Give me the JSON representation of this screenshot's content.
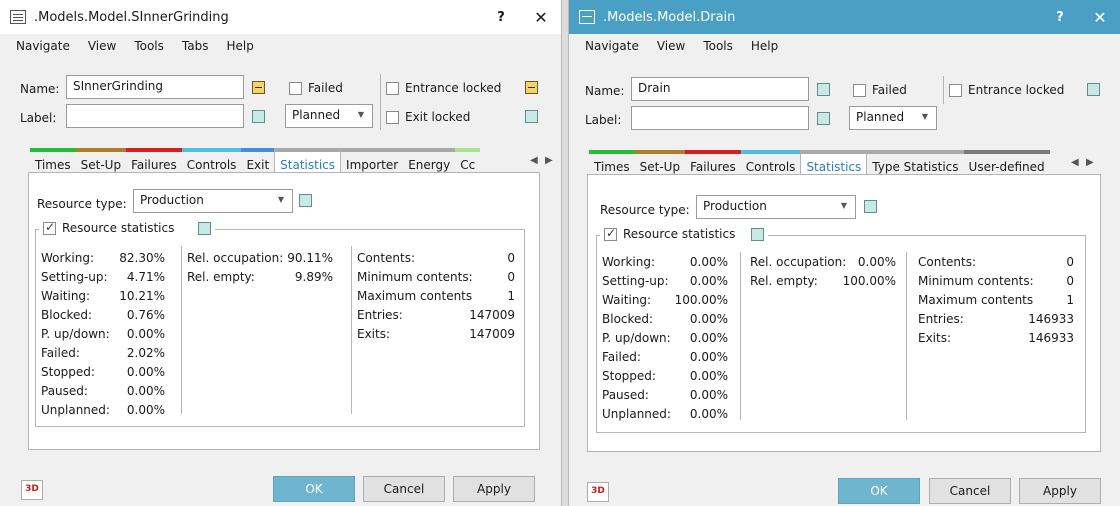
{
  "left": {
    "title": ".Models.Model.SInnerGrinding",
    "help": "?",
    "close": "✕",
    "menu": [
      "Navigate",
      "View",
      "Tools",
      "Tabs",
      "Help"
    ],
    "name_label": "Name:",
    "name_value": "SInnerGrinding",
    "label_label": "Label:",
    "label_value": "",
    "failed_label": "Failed",
    "status_value": "Planned",
    "entrance_locked_label": "Entrance locked",
    "exit_locked_label": "Exit locked",
    "tabs": [
      "Times",
      "Set-Up",
      "Failures",
      "Controls",
      "Exit",
      "Statistics",
      "Importer",
      "Energy",
      "Cc"
    ],
    "tab_colors": [
      "#1fbf3a",
      "#b07c2a",
      "#d62020",
      "#4fbfe0",
      "#3f8ee0",
      "#a9a9a9",
      "#a9a9a9",
      "#a9a9a9",
      "#a6e68a"
    ],
    "active_tab": "Statistics",
    "resource_type_label": "Resource type:",
    "resource_type_value": "Production",
    "resource_statistics_label": "Resource statistics",
    "col1": [
      {
        "label": "Working:",
        "value": "82.30%"
      },
      {
        "label": "Setting-up:",
        "value": "4.71%"
      },
      {
        "label": "Waiting:",
        "value": "10.21%"
      },
      {
        "label": "Blocked:",
        "value": "0.76%"
      },
      {
        "label": "P. up/down:",
        "value": "0.00%"
      },
      {
        "label": "Failed:",
        "value": "2.02%"
      },
      {
        "label": "Stopped:",
        "value": "0.00%"
      },
      {
        "label": "Paused:",
        "value": "0.00%"
      },
      {
        "label": "Unplanned:",
        "value": "0.00%"
      }
    ],
    "col2": [
      {
        "label": "Rel. occupation:",
        "value": "90.11%"
      },
      {
        "label": "Rel. empty:",
        "value": "9.89%"
      }
    ],
    "col3": [
      {
        "label": "Contents:",
        "value": "0"
      },
      {
        "label": "Minimum contents:",
        "value": "0"
      },
      {
        "label": "Maximum contents",
        "value": "1"
      },
      {
        "label": "Entries:",
        "value": "147009"
      },
      {
        "label": "Exits:",
        "value": "147009"
      }
    ],
    "btn_3d": "3D",
    "btn_ok": "OK",
    "btn_cancel": "Cancel",
    "btn_apply": "Apply"
  },
  "right": {
    "title": ".Models.Model.Drain",
    "help": "?",
    "close": "✕",
    "menu": [
      "Navigate",
      "View",
      "Tools",
      "Help"
    ],
    "name_label": "Name:",
    "name_value": "Drain",
    "label_label": "Label:",
    "label_value": "",
    "failed_label": "Failed",
    "status_value": "Planned",
    "entrance_locked_label": "Entrance locked",
    "tabs": [
      "Times",
      "Set-Up",
      "Failures",
      "Controls",
      "Statistics",
      "Type Statistics",
      "User-defined"
    ],
    "tab_colors": [
      "#1fbf3a",
      "#b07c2a",
      "#d62020",
      "#4fbfe0",
      "#a9a9a9",
      "#a9a9a9",
      "#7a7a7a"
    ],
    "active_tab": "Statistics",
    "resource_type_label": "Resource type:",
    "resource_type_value": "Production",
    "resource_statistics_label": "Resource statistics",
    "col1": [
      {
        "label": "Working:",
        "value": "0.00%"
      },
      {
        "label": "Setting-up:",
        "value": "0.00%"
      },
      {
        "label": "Waiting:",
        "value": "100.00%"
      },
      {
        "label": "Blocked:",
        "value": "0.00%"
      },
      {
        "label": "P. up/down:",
        "value": "0.00%"
      },
      {
        "label": "Failed:",
        "value": "0.00%"
      },
      {
        "label": "Stopped:",
        "value": "0.00%"
      },
      {
        "label": "Paused:",
        "value": "0.00%"
      },
      {
        "label": "Unplanned:",
        "value": "0.00%"
      }
    ],
    "col2": [
      {
        "label": "Rel. occupation:",
        "value": "0.00%"
      },
      {
        "label": "Rel. empty:",
        "value": "100.00%"
      }
    ],
    "col3": [
      {
        "label": "Contents:",
        "value": "0"
      },
      {
        "label": "Minimum contents:",
        "value": "0"
      },
      {
        "label": "Maximum contents",
        "value": "1"
      },
      {
        "label": "Entries:",
        "value": "146933"
      },
      {
        "label": "Exits:",
        "value": "146933"
      }
    ],
    "btn_3d": "3D",
    "btn_ok": "OK",
    "btn_cancel": "Cancel",
    "btn_apply": "Apply"
  }
}
